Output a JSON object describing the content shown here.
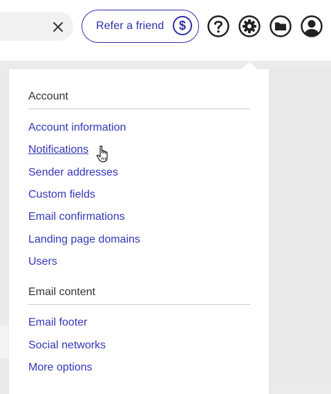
{
  "header": {
    "search_clear_icon": "close-icon",
    "refer_label": "Refer a friend",
    "refer_icon_glyph": "$",
    "icons": [
      "help-icon",
      "settings-gear-icon",
      "folder-icon",
      "user-avatar-icon"
    ]
  },
  "dropdown": {
    "sections": [
      {
        "title": "Account",
        "items": [
          "Account information",
          "Notifications",
          "Sender addresses",
          "Custom fields",
          "Email confirmations",
          "Landing page domains",
          "Users"
        ]
      },
      {
        "title": "Email content",
        "items": [
          "Email footer",
          "Social networks",
          "More options"
        ]
      }
    ],
    "hovered_item": "Notifications"
  },
  "colors": {
    "accent": "#2c2ea8",
    "link": "#3436b8",
    "text_dark": "#333333",
    "background": "#ebebeb"
  }
}
